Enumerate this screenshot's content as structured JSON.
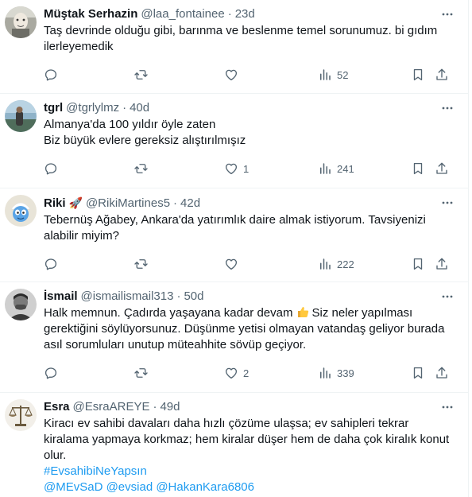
{
  "colors": {
    "text": "#0f1419",
    "secondary": "#536471",
    "link": "#1d9bf0",
    "divider": "#eff3f4"
  },
  "tweets": [
    {
      "name": "Müştak Serhazin",
      "handle": "@laa_fontainee",
      "time": "23d",
      "text": "Taş devrinde olduğu gibi, barınma ve beslenme temel sorunumuz. bi gıdım ilerleyemedik",
      "replies": "",
      "retweets": "",
      "likes": "",
      "views": "52",
      "avatar": "old-man-photo"
    },
    {
      "name": "tgrl",
      "handle": "@tgrlylmz",
      "time": "40d",
      "text": "Almanya'da 100 yıldır öyle zaten\nBiz büyük evlere gereksiz alıştırılmışız",
      "replies": "",
      "retweets": "",
      "likes": "1",
      "views": "241",
      "avatar": "lake-photo"
    },
    {
      "name": "Riki",
      "name_emoji": "🚀",
      "handle": "@RikiMartines5",
      "time": "42d",
      "text": "Tebernüş Ağabey, Ankara'da yatırımlık daire almak istiyorum. Tavsiyenizi alabilir miyim?",
      "replies": "",
      "retweets": "",
      "likes": "",
      "views": "222",
      "avatar": "smurf-cartoon"
    },
    {
      "name": "İsmail",
      "handle": "@ismailismail313",
      "time": "50d",
      "text_part1": "Halk memnun. Çadırda yaşayana kadar devam",
      "text_emoji": "thumbs-up",
      "text_part2": "Siz neler yapılması gerektiğini söylüyorsunuz. Düşünme yetisi olmayan vatandaş geliyor burada asıl sorumluları unutup müteahhite sövüp geçiyor.",
      "replies": "",
      "retweets": "",
      "likes": "2",
      "views": "339",
      "avatar": "man-portrait-bw"
    },
    {
      "name": "Esra",
      "handle": "@EsraAREYE",
      "time": "49d",
      "text": "Kiracı ev sahibi davaları daha hızlı çözüme ulaşsa; ev sahipleri tekrar kiralama yapmaya korkmaz; hem kiralar düşer hem de daha çok kiralık konut olur.",
      "hashtag": "#EvsahibiNeYapsın",
      "mentions": "@MEvSaD @evsiad @HakanKara6806",
      "avatar": "justice-scales"
    }
  ]
}
